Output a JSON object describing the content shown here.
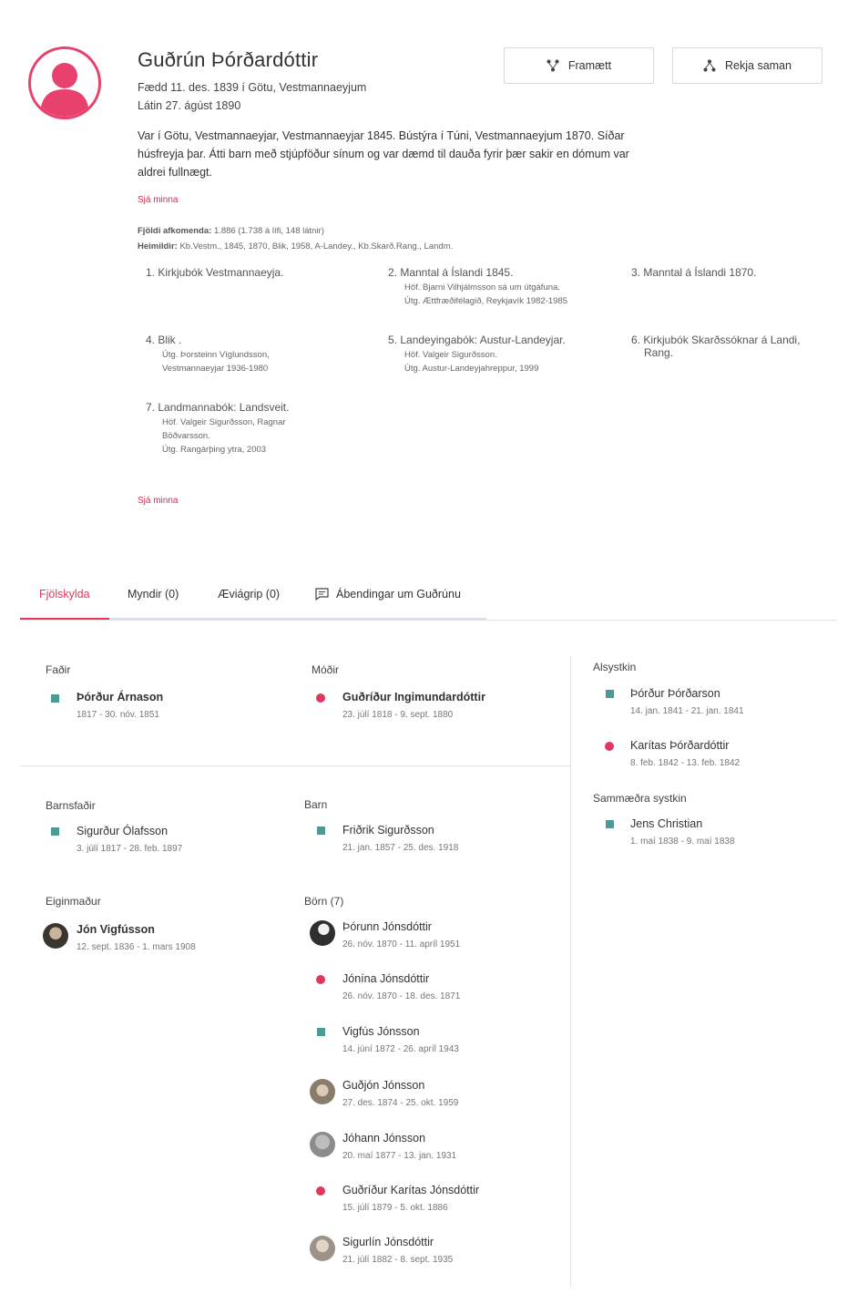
{
  "profile": {
    "name": "Guðrún Þórðardóttir",
    "born": "Fædd 11. des. 1839 í Götu, Vestmannaeyjum",
    "died": "Látin 27. ágúst 1890",
    "bio": "Var í Götu, Vestmannaeyjar, Vestmannaeyjar 1845. Bústýra í Túni, Vestmannaeyjum 1870. Síðar húsfreyja þar. Átti barn með stjúpföður sínum og var dæmd til dauða fyrir þær sakir en dómum var aldrei fullnægt.",
    "see_less_1": "Sjá minna",
    "see_less_2": "Sjá minna",
    "descendants_label": "Fjöldi afkomenda:",
    "descendants_value": "1.886 (1.738 á lífi, 148 látnir)",
    "sources_label": "Heimildir:",
    "sources_value": "Kb.Vestm., 1845, 1870, Blik, 1958, A-Landey., Kb.Skarð.Rang., Landm."
  },
  "actions": {
    "ancestors_label": "Framætt",
    "trace_label": "Rekja saman"
  },
  "sources": [
    {
      "title": "1. Kirkjubók Vestmannaeyja.",
      "details": []
    },
    {
      "title": "2. Manntal á Íslandi 1845.",
      "details": [
        "Höf. Bjarni Vilhjálmsson sá um útgáfuna.",
        "Útg. Ættfræðifélagið, Reykjavík 1982-1985"
      ]
    },
    {
      "title": "3. Manntal á Íslandi 1870.",
      "details": []
    },
    {
      "title": "4. Blik .",
      "details": [
        "Útg. Þorsteinn Víglundsson,",
        "Vestmannaeyjar 1936-1980"
      ]
    },
    {
      "title": "5. Landeyingabók: Austur-Landeyjar.",
      "details": [
        "Höf. Valgeir Sigurðsson.",
        "Útg. Austur-Landeyjahreppur, 1999"
      ]
    },
    {
      "title": "6. Kirkjubók Skarðssóknar á Landi,",
      "title2": "Rang.",
      "details": []
    },
    {
      "title": "7. Landmannabók: Landsveit.",
      "details": [
        "Höf. Valgeir Sigurðsson, Ragnar",
        "Böðvarsson.",
        "Útg. Rangárþing ytra, 2003"
      ]
    }
  ],
  "tabs": [
    {
      "label": "Fjölskylda",
      "active": true
    },
    {
      "label": "Myndir (0)"
    },
    {
      "label": "Æviágrip (0)"
    },
    {
      "label": "Ábendingar um Guðrúnu"
    }
  ],
  "family": {
    "father": {
      "label": "Faðir",
      "name": "Þórður Árnason",
      "dates": "1817 - 30. nóv. 1851"
    },
    "mother": {
      "label": "Móðir",
      "name": "Guðríður Ingimundardóttir",
      "dates": "23. júlí 1818 - 9. sept. 1880"
    },
    "full_siblings": {
      "label": "Alsystkin",
      "people": [
        {
          "name": "Þórður Þórðarson",
          "dates": "14. jan. 1841 - 21. jan. 1841"
        },
        {
          "name": "Karítas Þórðardóttir",
          "dates": "8. feb. 1842 - 13. feb. 1842"
        }
      ]
    },
    "half_siblings": {
      "label": "Sammæðra systkin",
      "people": [
        {
          "name": "Jens Christian",
          "dates": "1. maí 1838 - 9. maí 1838"
        }
      ]
    },
    "child_father": {
      "label": "Barnsfaðir",
      "name": "Sigurður Ólafsson",
      "dates": "3. júlí 1817 - 28. feb. 1897"
    },
    "child": {
      "label": "Barn",
      "name": "Friðrik Sigurðsson",
      "dates": "21. jan. 1857 - 25. des. 1918"
    },
    "husband": {
      "label": "Eiginmaður",
      "name": "Jón Vigfússon",
      "dates": "12. sept. 1836 - 1. mars 1908"
    },
    "children": {
      "label": "Börn (7)",
      "people": [
        {
          "name": "Þórunn Jónsdóttir",
          "dates": "26. nóv. 1870 - 11. apríl 1951"
        },
        {
          "name": "Jónína Jónsdóttir",
          "dates": "26. nóv. 1870 - 18. des. 1871"
        },
        {
          "name": "Vigfús Jónsson",
          "dates": "14. júní 1872 - 26. apríl 1943"
        },
        {
          "name": "Guðjón Jónsson",
          "dates": "27. des. 1874 - 25. okt. 1959"
        },
        {
          "name": "Jóhann Jónsson",
          "dates": "20. maí 1877 - 13. jan. 1931"
        },
        {
          "name": "Guðríður Karítas Jónsdóttir",
          "dates": "15. júlí 1879 - 5. okt. 1886"
        },
        {
          "name": "Sigurlín Jónsdóttir",
          "dates": "21. júlí 1882 - 8. sept. 1935"
        }
      ]
    }
  },
  "colors": {
    "accent": "#e0375f",
    "male_marker": "#4a9a95",
    "female_marker": "#e0375f"
  }
}
